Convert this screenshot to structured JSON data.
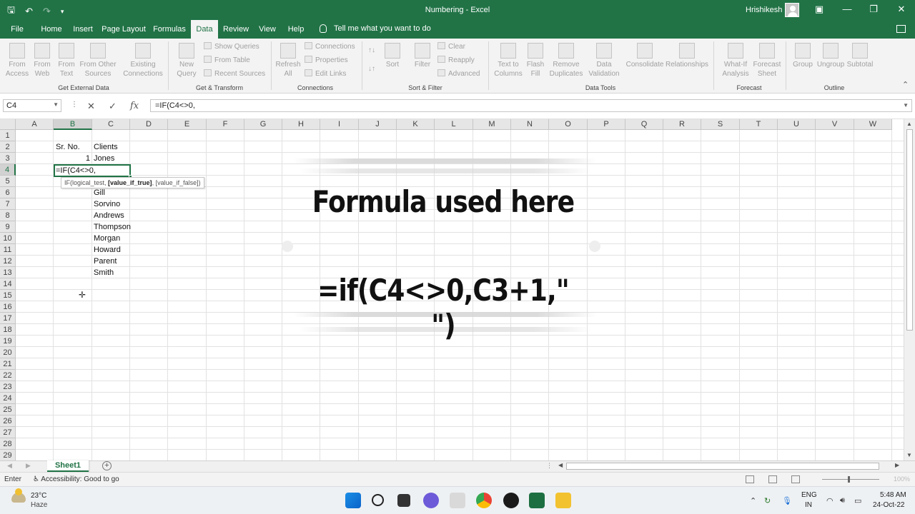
{
  "titlebar": {
    "title": "Numbering - Excel",
    "user": "Hrishikesh",
    "save_icon": "save-icon",
    "undo_icon": "undo-icon",
    "redo_icon": "redo-icon"
  },
  "menu": {
    "tabs": [
      "File",
      "Home",
      "Insert",
      "Page Layout",
      "Formulas",
      "Data",
      "Review",
      "View",
      "Help"
    ],
    "active_tab": "Data",
    "tell_me": "Tell me what you want to do"
  },
  "ribbon": {
    "get_external_data": {
      "label": "Get External Data",
      "buttons": [
        "From Access",
        "From Web",
        "From Text",
        "From Other Sources",
        "Existing Connections"
      ]
    },
    "get_transform": {
      "label": "Get & Transform",
      "new_query": "New Query",
      "small": [
        "Show Queries",
        "From Table",
        "Recent Sources"
      ]
    },
    "connections": {
      "label": "Connections",
      "refresh_all": "Refresh All",
      "small": [
        "Connections",
        "Properties",
        "Edit Links"
      ]
    },
    "sort_filter": {
      "label": "Sort & Filter",
      "sort": "Sort",
      "filter": "Filter",
      "small": [
        "Clear",
        "Reapply",
        "Advanced"
      ]
    },
    "data_tools": {
      "label": "Data Tools",
      "buttons": [
        "Text to Columns",
        "Flash Fill",
        "Remove Duplicates",
        "Data Validation",
        "Consolidate",
        "Relationships"
      ]
    },
    "forecast": {
      "label": "Forecast",
      "buttons": [
        "What-If Analysis",
        "Forecast Sheet"
      ]
    },
    "outline": {
      "label": "Outline",
      "buttons": [
        "Group",
        "Ungroup",
        "Subtotal"
      ]
    }
  },
  "formula_bar": {
    "name_box": "C4",
    "formula": "=IF(C4<>0,"
  },
  "grid": {
    "columns": [
      "A",
      "B",
      "C",
      "D",
      "E",
      "F",
      "G",
      "H",
      "I",
      "J",
      "K",
      "L",
      "M",
      "N",
      "O",
      "P",
      "Q",
      "R",
      "S",
      "T",
      "U",
      "V",
      "W"
    ],
    "selected_column": "B",
    "rows": [
      "1",
      "2",
      "3",
      "4",
      "5",
      "6",
      "7",
      "8",
      "9",
      "10",
      "11",
      "12",
      "13",
      "14",
      "15",
      "16",
      "17",
      "18",
      "19",
      "20",
      "21",
      "22",
      "23",
      "24",
      "25",
      "26",
      "27",
      "28",
      "29"
    ],
    "selected_row": "4",
    "header_srno": "Sr. No.",
    "header_clients": "Clients",
    "b3_value": "1",
    "clients": [
      "Jones",
      "Gill",
      "Sorvino",
      "Andrews",
      "Thompson",
      "Morgan",
      "Howard",
      "Parent",
      "Smith"
    ],
    "edit_value": "=IF(C4<>0,",
    "tooltip": {
      "fn": "IF(logical_test, ",
      "bold": "[value_if_true]",
      "rest": ", [value_if_false])"
    }
  },
  "overlay": {
    "heading": "Formula used here",
    "formula": "=if(C4<>0,C3+1,\" \")"
  },
  "sheets": {
    "tabs": [
      "Sheet1"
    ]
  },
  "status": {
    "mode": "Enter",
    "accessibility": "Accessibility: Good to go",
    "zoom": "100%"
  },
  "taskbar": {
    "temperature": "23°C",
    "weather": "Haze",
    "lang_top": "ENG",
    "lang_bottom": "IN",
    "time": "5:48 AM",
    "date": "24-Oct-22"
  },
  "colors": {
    "excel_green": "#217346",
    "active_tab_text": "#217346",
    "ribbon_bg": "#f3f3f3"
  }
}
